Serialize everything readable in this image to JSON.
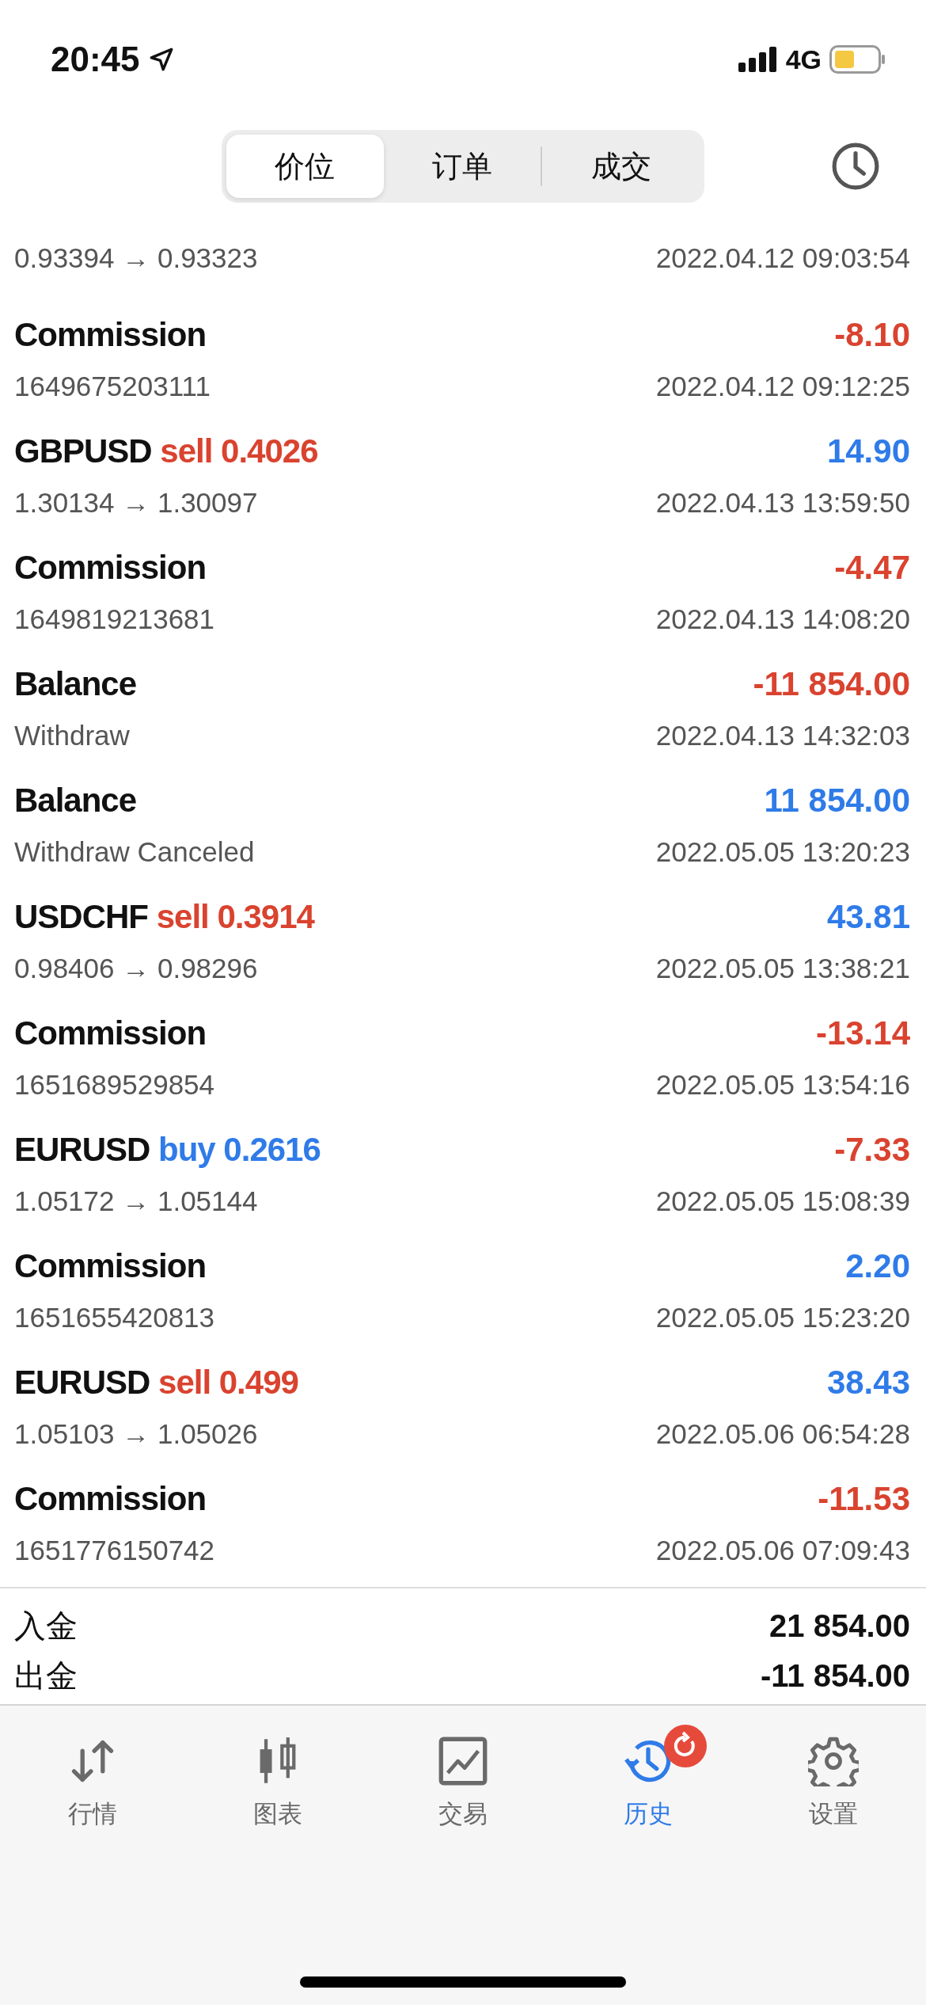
{
  "status_bar": {
    "time": "20:45",
    "network": "4G"
  },
  "segments": [
    {
      "label": "价位",
      "selected": true
    },
    {
      "label": "订单",
      "selected": false
    },
    {
      "label": "成交",
      "selected": false
    }
  ],
  "deals": [
    {
      "kind": "partial",
      "detail": "0.93394 → 0.93323",
      "time": "2022.04.12 09:03:54"
    },
    {
      "kind": "commission",
      "title": "Commission",
      "amount": "-8.10",
      "positive": false,
      "detail": "1649675203111",
      "time": "2022.04.12 09:12:25"
    },
    {
      "kind": "trade",
      "title": "GBPUSD",
      "side": "sell",
      "volume": "0.4026",
      "amount": "14.90",
      "positive": true,
      "detail": "1.30134 → 1.30097",
      "time": "2022.04.13 13:59:50"
    },
    {
      "kind": "commission",
      "title": "Commission",
      "amount": "-4.47",
      "positive": false,
      "detail": "1649819213681",
      "time": "2022.04.13 14:08:20"
    },
    {
      "kind": "balance",
      "title": "Balance",
      "amount": "-11 854.00",
      "positive": false,
      "detail": "Withdraw",
      "time": "2022.04.13 14:32:03"
    },
    {
      "kind": "balance",
      "title": "Balance",
      "amount": "11 854.00",
      "positive": true,
      "detail": "Withdraw Canceled",
      "time": "2022.05.05 13:20:23"
    },
    {
      "kind": "trade",
      "title": "USDCHF",
      "side": "sell",
      "volume": "0.3914",
      "amount": "43.81",
      "positive": true,
      "detail": "0.98406 → 0.98296",
      "time": "2022.05.05 13:38:21"
    },
    {
      "kind": "commission",
      "title": "Commission",
      "amount": "-13.14",
      "positive": false,
      "detail": "1651689529854",
      "time": "2022.05.05 13:54:16"
    },
    {
      "kind": "trade",
      "title": "EURUSD",
      "side": "buy",
      "volume": "0.2616",
      "amount": "-7.33",
      "positive": false,
      "detail": "1.05172 → 1.05144",
      "time": "2022.05.05 15:08:39"
    },
    {
      "kind": "commission",
      "title": "Commission",
      "amount": "2.20",
      "positive": true,
      "detail": "1651655420813",
      "time": "2022.05.05 15:23:20"
    },
    {
      "kind": "trade",
      "title": "EURUSD",
      "side": "sell",
      "volume": "0.499",
      "amount": "38.43",
      "positive": true,
      "detail": "1.05103 → 1.05026",
      "time": "2022.05.06 06:54:28"
    },
    {
      "kind": "commission",
      "title": "Commission",
      "amount": "-11.53",
      "positive": false,
      "detail": "1651776150742",
      "time": "2022.05.06 07:09:43"
    }
  ],
  "summary": [
    {
      "label": "入金",
      "value": "21 854.00"
    },
    {
      "label": "出金",
      "value": "-11 854.00"
    }
  ],
  "tab_bar": [
    {
      "kind": "quotes",
      "label": "行情",
      "selected": false,
      "badge": false
    },
    {
      "kind": "chart",
      "label": "图表",
      "selected": false,
      "badge": false
    },
    {
      "kind": "trade",
      "label": "交易",
      "selected": false,
      "badge": false
    },
    {
      "kind": "history",
      "label": "历史",
      "selected": true,
      "badge": true
    },
    {
      "kind": "settings",
      "label": "设置",
      "selected": false,
      "badge": false
    }
  ]
}
